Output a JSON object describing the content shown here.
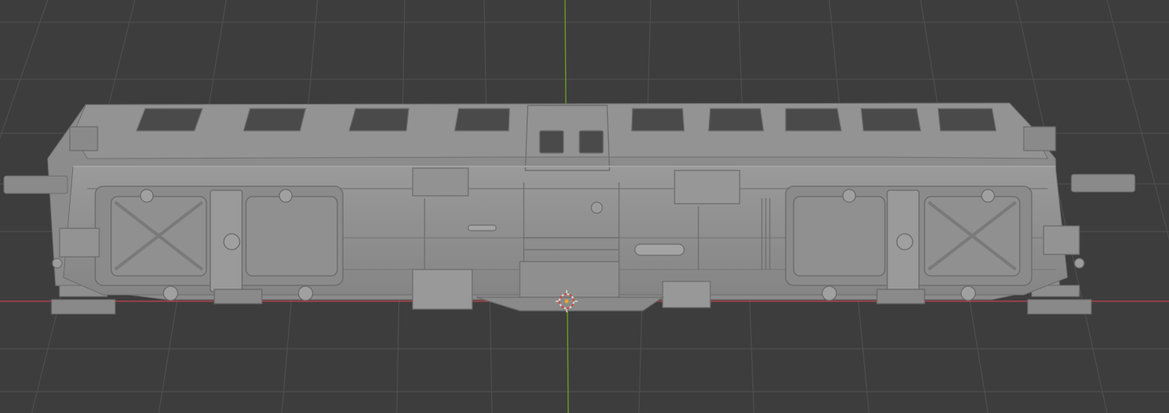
{
  "viewport": {
    "background_color": "#3d3d3d",
    "grid_color": "#4e4e4e",
    "x_axis_color": "#b0404a",
    "y_axis_color": "#6d9a1f",
    "model": {
      "object_type": "railway-carriage-underframe",
      "body_color": "#8e8e8e",
      "shadow_color": "#6f6f6f",
      "highlight_color": "#a3a3a3"
    },
    "cursor_3d": {
      "icon": "3d-cursor-icon",
      "ring_color": "#d8d8d8",
      "accent_color": "#c74a3a"
    }
  }
}
